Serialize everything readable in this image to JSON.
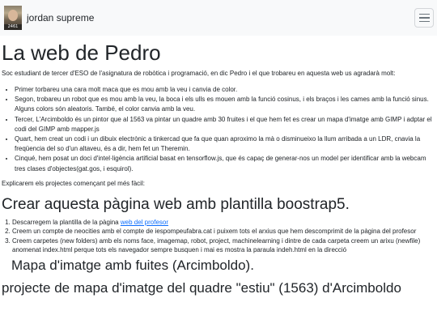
{
  "navbar": {
    "brand_name": "jordan supreme",
    "avatar_tag": "2461"
  },
  "page": {
    "title": "La web de Pedro",
    "intro": "Soc estudiant de tercer d'ESO de l'asignatura de robòtica i programació, en dic Pedro i el que trobareu en aquesta web us agradarà molt:",
    "projects": [
      "Primer torbareu una cara molt maca que es mou amb la veu i canvia de color.",
      "Segon, trobareu un robot que es mou amb la veu, la boca i els ulls es mouen amb la funció cosinus, i els braços i les cames amb la funció sinus. Alguns colors són aleatoris. També, el color canvia amb la veu.",
      "Tercer, L'Arcimboldo és un pintor que al 1563 va pintar un quadre amb 30 fruites i el que hem fet es crear un mapa d'imatge amb GIMP i adptar el codi del GIMP amb mapper.js",
      "Quart, hem creat un codi i un dibuix electrònic a tinkercad que fa que quan aproximo la mà o disminueixo la llum arribada a un LDR, cnavia la freqüencia del so d'un altaveu, és a dir, hem fet un Theremin.",
      "Cinqué, hem posat un doci d'intel·ligència artificial basat en tensorflow.js, que és capaç de generar-nos un model per identificar amb la webcam tres clases d'objectes(gat.gos, i esquirol)."
    ],
    "outro": "Explicarem els projectes començant pel més fàcil:"
  },
  "section1": {
    "heading": "Crear aquesta pàgina web amb plantilla boostrap5.",
    "step1_prefix": "Descarregem la plantilla de la pàgina ",
    "step1_link": "web del profesor",
    "step2": "Creem un compte de neocities amb el compte de iespompeufabra.cat i puixem tots el arxius que hem descomprimit de la pàgina del profesor",
    "step3": "Creem carpetes (new folders) amb els noms face, imagemap, robot, project, machinelearning i dintre de cada carpeta creem un arixu (newfile) anomenat index.html perque tots els navegador sempre busquen i mai es mostra la paraula indeh.html en la direcció"
  },
  "section2": {
    "heading": "Mapa d'imatge amb fuites (Arcimboldo).",
    "cut_heading": "projecte de mapa d'imatge del quadre \"estiu\" (1563) d'Arcimboldo"
  }
}
